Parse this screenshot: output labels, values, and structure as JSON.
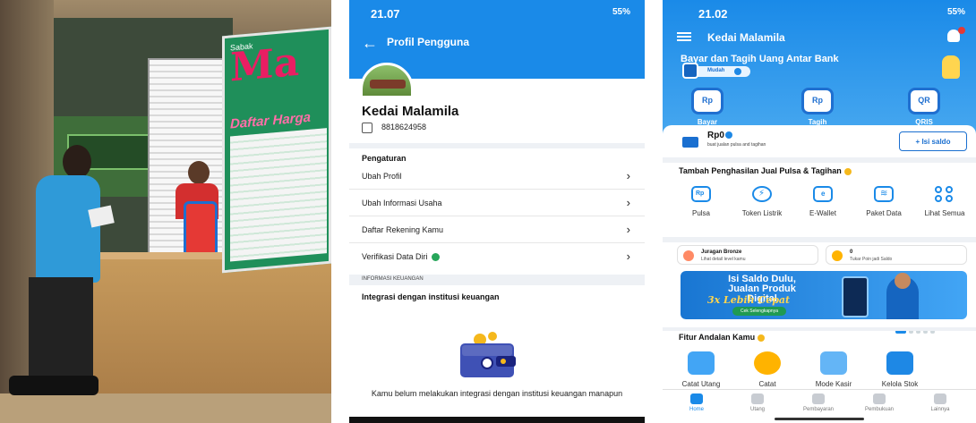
{
  "photo": {
    "banner_small": "Sabak",
    "banner_logo": "Ma",
    "banner_title": "Daftar Harga"
  },
  "profile": {
    "status_time": "21.07",
    "status_right": "55%",
    "title": "Profil Pengguna",
    "name": "Kedai Malamila",
    "phone": "8818624958",
    "settings_header": "Pengaturan",
    "menu": [
      {
        "label": "Ubah Profil"
      },
      {
        "label": "Ubah Informasi Usaha"
      },
      {
        "label": "Daftar Rekening Kamu"
      },
      {
        "label": "Verifikasi Data Diri"
      }
    ],
    "info_header": "INFORMASI KEUANGAN",
    "integration_title": "Integrasi dengan institusi keuangan",
    "empty_text": "Kamu belum melakukan integrasi dengan institusi keuangan manapun"
  },
  "home": {
    "status_time": "21.02",
    "status_right": "55%",
    "app_title": "Kedai Malamila",
    "promo_title": "Bayar dan Tagih Uang Antar Bank",
    "promo_badge": "Mudah",
    "actions": [
      {
        "label": "Bayar",
        "icon_text": "Rp"
      },
      {
        "label": "Tagih",
        "icon_text": "Rp"
      },
      {
        "label": "QRIS",
        "icon_text": "QR"
      }
    ],
    "balance": "Rp0",
    "balance_sub": "buat jualan pulsa and tagihan",
    "topup_button": "+ Isi saldo",
    "services_header": "Tambah Penghasilan Jual Pulsa & Tagihan",
    "services": [
      {
        "label": "Pulsa",
        "icon": "rp-phone-icon",
        "glyph": "Rp"
      },
      {
        "label": "Token Listrik",
        "icon": "lightning-icon",
        "glyph": "⚡"
      },
      {
        "label": "E-Wallet",
        "icon": "wallet-icon",
        "glyph": "e"
      },
      {
        "label": "Paket Data",
        "icon": "wifi-icon",
        "glyph": "≋"
      },
      {
        "label": "Lihat Semua",
        "icon": "grid-icon",
        "glyph": ""
      }
    ],
    "mini_cards": [
      {
        "title": "Juragan Bronze",
        "sub": "Lihat detail level kamu",
        "color": "#ff8a65"
      },
      {
        "title": "0",
        "sub": "Tukar Poin jadi Saldo",
        "color": "#ffb300"
      }
    ],
    "banner_line1": "Isi Saldo Dulu,",
    "banner_line2": "Jualan Produk Digital",
    "banner_line3": "3x Lebih Cepat",
    "banner_cta": "Cek Selengkapnya",
    "features_header": "Fitur Andalan Kamu",
    "features": [
      {
        "label": "Catat Utang"
      },
      {
        "label": "Catat"
      },
      {
        "label": "Mode Kasir"
      },
      {
        "label": "Kelola Stok"
      }
    ],
    "nav": [
      {
        "label": "Home"
      },
      {
        "label": "Utang"
      },
      {
        "label": "Pembayaran"
      },
      {
        "label": "Pembukuan"
      },
      {
        "label": "Lainnya"
      }
    ]
  }
}
